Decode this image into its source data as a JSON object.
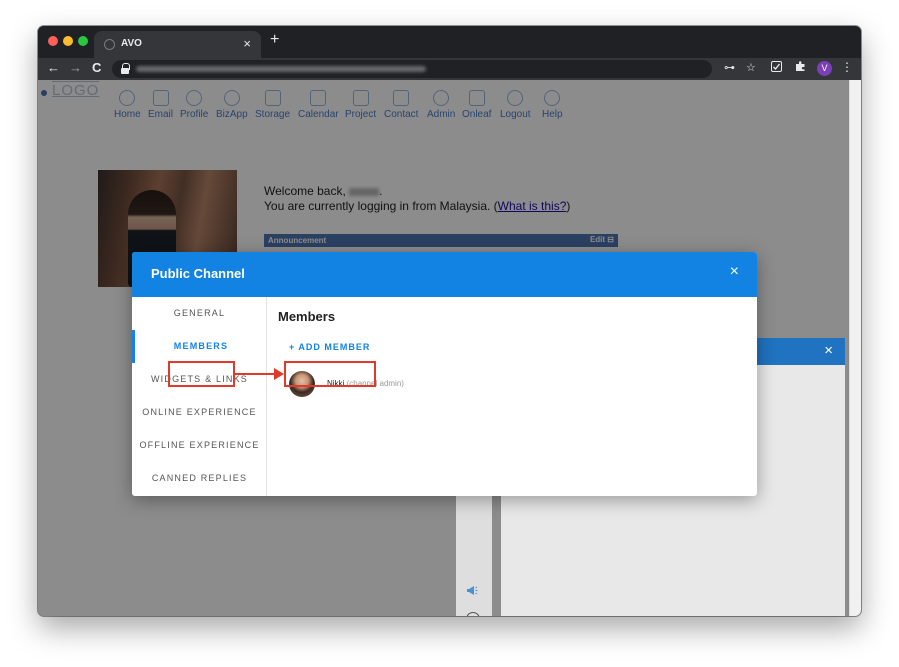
{
  "browser": {
    "tab_title": "AVO",
    "tab_close": "×",
    "new_tab": "+",
    "back": "←",
    "forward": "→",
    "reload": "C",
    "key_icon": "⊶",
    "star_icon": "☆",
    "profile_initial": "V",
    "menu_icon": "⋮"
  },
  "logo": {
    "text": "LOGO"
  },
  "app_nav": [
    {
      "label": "Home",
      "icon": "home-icon"
    },
    {
      "label": "Email",
      "icon": "email-icon"
    },
    {
      "label": "Profile",
      "icon": "profile-icon"
    },
    {
      "label": "BizApp",
      "icon": "bizapp-icon"
    },
    {
      "label": "Storage",
      "icon": "storage-icon"
    },
    {
      "label": "Calendar",
      "icon": "calendar-icon"
    },
    {
      "label": "Project",
      "icon": "project-icon"
    },
    {
      "label": "Contact",
      "icon": "contact-icon"
    },
    {
      "label": "Admin",
      "icon": "admin-icon"
    },
    {
      "label": "Onleaf",
      "icon": "onleaf-icon"
    },
    {
      "label": "Logout",
      "icon": "logout-icon"
    },
    {
      "label": "Help",
      "icon": "help-icon"
    }
  ],
  "welcome": {
    "line1": "Welcome back,",
    "line1_end": ".",
    "line2": "You are currently logging in from Malaysia. (",
    "link": "What is this?",
    "line2_end": ")"
  },
  "announcement": {
    "title": "Announcement",
    "edit": "Edit"
  },
  "modal": {
    "title": "Public Channel",
    "close": "×",
    "nav": [
      "GENERAL",
      "MEMBERS",
      "WIDGETS & LINKS",
      "ONLINE EXPERIENCE",
      "OFFLINE EXPERIENCE",
      "CANNED REPLIES"
    ],
    "active_nav": "MEMBERS",
    "section_title": "Members",
    "add_member": "+ ADD MEMBER",
    "members": [
      {
        "name": "Nikki",
        "role": "(channel admin)"
      }
    ]
  },
  "background_panel": {
    "close": "×"
  },
  "colors": {
    "modal_header": "#1283e3",
    "annotation": "#e03a2c",
    "app_nav_link": "#4a7cc9"
  }
}
